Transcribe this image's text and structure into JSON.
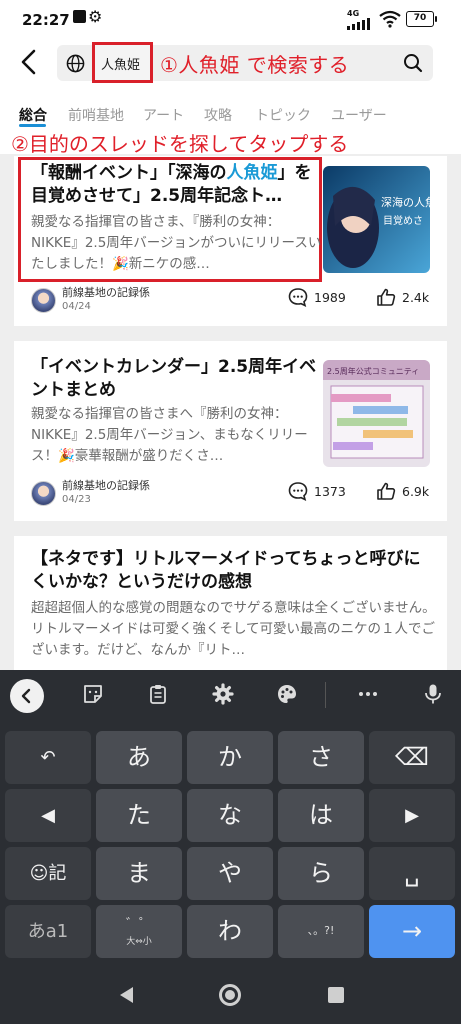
{
  "status_bar": {
    "time": "22:27",
    "network": "4G",
    "battery": "70"
  },
  "search": {
    "query": "人魚姫"
  },
  "annotations": {
    "step1": "①人魚姫 で検索する",
    "step2": "②目的のスレッドを探してタップする"
  },
  "tabs": [
    {
      "label": "総合",
      "active": true
    },
    {
      "label": "前哨基地",
      "active": false
    },
    {
      "label": "アート",
      "active": false
    },
    {
      "label": "攻略",
      "active": false
    },
    {
      "label": "トピック",
      "active": false
    },
    {
      "label": "ユーザー",
      "active": false
    }
  ],
  "posts": [
    {
      "title_part1": "「報酬イベント」「深海の",
      "title_highlight": "人魚姫",
      "title_part2": "」を目覚めさせて」2.5周年記念ト…",
      "body": "親愛なる指揮官の皆さま、『勝利の女神：NIKKE』2.5周年バージョンがついにリリースいたしました！🎉新ニケの感…",
      "thumbnail_text": "深海の人魚姫を目覚めさせて",
      "author": "前線基地の記録係",
      "date": "04/24",
      "comments": "1989",
      "likes": "2.4k"
    },
    {
      "title": "「イベントカレンダー」2.5周年イベントまとめ",
      "body": "親愛なる指揮官の皆さまへ『勝利の女神：NIKKE』2.5周年バージョン、まもなくリリース！🎉豪華報酬が盛りだくさ…",
      "thumbnail_text": "2.5周年公式コミュニティ報酬イベントカレンダー",
      "author": "前線基地の記録係",
      "date": "04/23",
      "comments": "1373",
      "likes": "6.9k"
    },
    {
      "title": "【ネタです】リトルマーメイドってちょっと呼びにくいかな？というだけの感想",
      "body": "超超超個人的な感覚の問題なのでサゲる意味は全くございません。リトルマーメイドは可愛く強くそして可愛い最高のニケの１人でございます。だけど、なんか『リト…"
    }
  ],
  "keyboard": {
    "row1": [
      "あ",
      "か",
      "さ"
    ],
    "row2": [
      "た",
      "な",
      "は"
    ],
    "row3": [
      "ま",
      "や",
      "ら"
    ],
    "row4_main": "わ",
    "emoji_label": "記",
    "kana_label": "あa1",
    "dakuten_label": "゛゜",
    "dakuten_sub": "大⇔小",
    "punct_label": "、。?!",
    "space_glyph": "␣",
    "enter_glyph": "→",
    "backspace_glyph": "⌫",
    "undo_glyph": "↶"
  },
  "colors": {
    "accent_red": "#e0202a",
    "link_blue": "#1a9ad6",
    "enter_blue": "#4f93f0"
  }
}
